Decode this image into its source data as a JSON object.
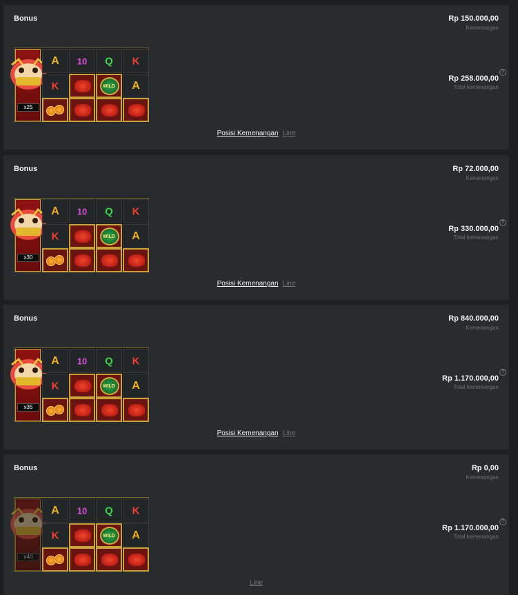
{
  "cards": [
    {
      "title": "Bonus",
      "win_amount": "Rp 150.000,00",
      "win_label": "Kemenangan",
      "total_amount": "Rp 258.000,00",
      "total_label": "Total kemenangan",
      "multiplier": "x25",
      "links": {
        "positions": "Posisi Kemenangan",
        "line": "Line"
      }
    },
    {
      "title": "Bonus",
      "win_amount": "Rp 72.000,00",
      "win_label": "Kemenangan",
      "total_amount": "Rp 330.000,00",
      "total_label": "Total kemenangan",
      "multiplier": "x30",
      "links": {
        "positions": "Posisi Kemenangan",
        "line": "Line"
      }
    },
    {
      "title": "Bonus",
      "win_amount": "Rp 840.000,00",
      "win_label": "Kemenangan",
      "total_amount": "Rp 1.170.000,00",
      "total_label": "Total kemenangan",
      "multiplier": "x35",
      "links": {
        "positions": "Posisi Kemenangan",
        "line": "Line"
      }
    },
    {
      "title": "Bonus",
      "win_amount": "Rp 0,00",
      "win_label": "Kemenangan",
      "total_amount": "Rp 1.170.000,00",
      "total_label": "Total kemenangan",
      "multiplier": "x40",
      "links": {
        "line": "Line"
      }
    }
  ],
  "grid_symbols": [
    [
      "a",
      "10",
      "q",
      "k"
    ],
    [
      "k",
      "lantern",
      "wild",
      "a"
    ],
    [
      "lantern",
      "coin",
      "lantern",
      "lantern",
      "lantern"
    ]
  ],
  "symbol_text": {
    "a": "A",
    "10": "10",
    "q": "Q",
    "k": "K",
    "wild": "WILD"
  },
  "colors": {
    "card_bg": "#282c2f",
    "page_bg": "#1d2022",
    "muted": "#6c7276",
    "gold": "#c9a23c"
  }
}
